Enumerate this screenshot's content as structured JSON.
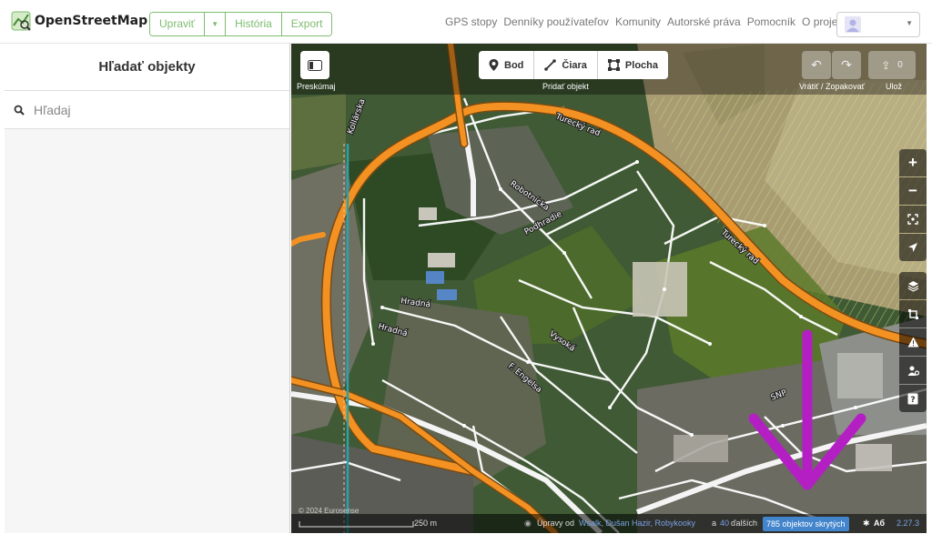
{
  "app": {
    "name": "OpenStreetMap"
  },
  "navbar": {
    "edit_label": "Upraviť",
    "history_label": "História",
    "export_label": "Export",
    "links": [
      "GPS stopy",
      "Denníky používateľov",
      "Komunity",
      "Autorské práva",
      "Pomocník",
      "O projekte"
    ]
  },
  "sidebar": {
    "title": "Hľadať objekty",
    "search_placeholder": "Hľadaj"
  },
  "toolbar": {
    "inspect_label": "Preskúmaj",
    "add_label": "Pridať objekt",
    "point_label": "Bod",
    "line_label": "Čiara",
    "area_label": "Plocha",
    "undo_redo_label": "Vrátiť / Zopakovať",
    "save_label": "Ulož",
    "save_count": "0"
  },
  "map_labels": {
    "turecky_rad_1": "Turecký rad",
    "turecky_rad_2": "Turecký rad",
    "robotnicka": "Robotnícka",
    "podhradie": "Podhradie",
    "hradna_1": "Hradná",
    "hradna_2": "Hradná",
    "vysoka": "Vysoká",
    "engelsa": "F. Engelsa",
    "snp": "SNP",
    "kollarska": "Kollárska"
  },
  "footer": {
    "scale": "250 m",
    "edits_prefix": "Úpravy od",
    "editors": "Wsalk, Dušan Hazir, Robykooky",
    "and": "a",
    "more_count": "40",
    "more_suffix": "ďalších",
    "hidden_features": "785 objektov skrytých",
    "language": "Aб",
    "version": "2.27.3",
    "imagery_credit": "© 2024 Eurosense"
  },
  "colors": {
    "osm_green": "#7ebc6f",
    "highway_orange": "#f39222",
    "annotation_arrow": "#b41fc4",
    "badge_blue": "#4385cc"
  }
}
